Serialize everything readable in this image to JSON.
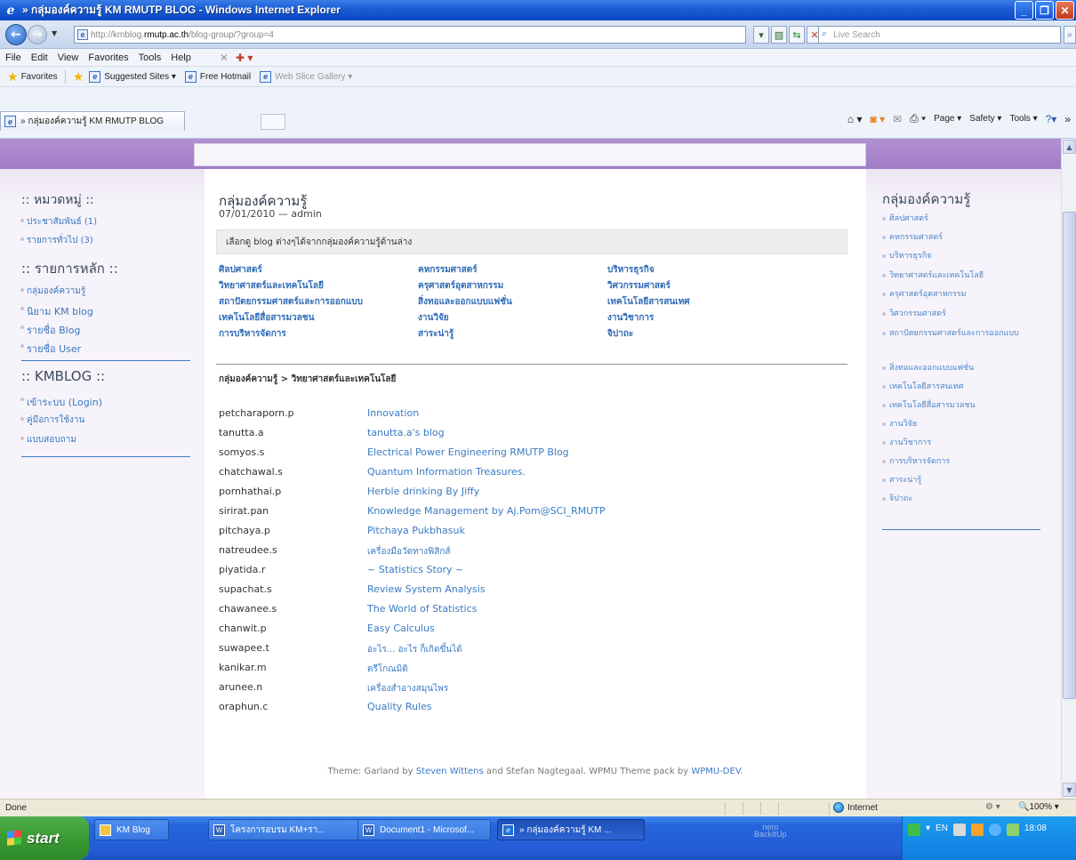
{
  "window": {
    "title": "» กลุ่มองค์ความรู้ KM RMUTP BLOG - Windows Internet Explorer"
  },
  "address": {
    "url_prefix": "http://kmblog.",
    "url_host": "rmutp.ac.th",
    "url_suffix": "/blog-group/?group=4",
    "search_placeholder": "Live Search"
  },
  "menu": [
    "File",
    "Edit",
    "View",
    "Favorites",
    "Tools",
    "Help"
  ],
  "favorites": {
    "label": "Favorites",
    "items": [
      {
        "label": "Suggested Sites ▾",
        "grey": false
      },
      {
        "label": "Free Hotmail",
        "grey": false
      },
      {
        "label": "Web Slice Gallery ▾",
        "grey": true
      }
    ]
  },
  "tab": {
    "label": "» กลุ่มองค์ความรู้ KM RMUTP BLOG"
  },
  "commandbar": [
    "Page ▾",
    "Safety ▾",
    "Tools ▾"
  ],
  "left_sidebar": {
    "h1": ":: หมวดหมู่ ::",
    "cats": [
      "ประชาสัมพันธ์ (1)",
      "รายการทั่วไป (3)"
    ],
    "h2": ":: รายการหลัก ::",
    "main": [
      "กลุ่มองค์ความรู้",
      "นิยาม KM blog",
      "รายชื่อ Blog",
      "รายชื่อ User"
    ],
    "h3": ":: KMBLOG ::",
    "km": [
      "เข้าระบบ (Login)",
      "คู่มือการใช้งาน",
      "แบบสอบถาม"
    ]
  },
  "main": {
    "title": "กลุ่มองค์ความรู้",
    "date": "07/01/2010 — admin",
    "info": "เลือกดู blog ต่างๆได้จากกลุ่มองค์ความรู้ด้านล่าง",
    "categories": [
      [
        "ศิลปศาสตร์",
        "คหกรรมศาสตร์",
        "บริหารธุรกิจ"
      ],
      [
        "วิทยาศาสตร์และเทคโนโลยี",
        "ครุศาสตร์อุตสาหกรรม",
        "วิศวกรรมศาสตร์"
      ],
      [
        "สถาปัตยกรรมศาสตร์และการออกแบบ",
        "สิ่งทอและออกแบบแฟชั่น",
        "เทคโนโลยีสารสนเทศ"
      ],
      [
        "เทคโนโลยีสื่อสารมวลชน",
        "งานวิจัย",
        "งานวิชาการ"
      ],
      [
        "การบริหารจัดการ",
        "สาระน่ารู้",
        "จิปาถะ"
      ]
    ],
    "breadcrumb": "กลุ่มองค์ความรู้ > วิทยาศาสตร์และเทคโนโลยี",
    "blogs": [
      {
        "user": "petcharaporn.p",
        "blog": "Innovation"
      },
      {
        "user": "tanutta.a",
        "blog": "tanutta.a's blog"
      },
      {
        "user": "somyos.s",
        "blog": "Electrical Power Engineering RMUTP Blog"
      },
      {
        "user": "chatchawal.s",
        "blog": "Quantum Information Treasures."
      },
      {
        "user": "pornhathai.p",
        "blog": "Herble drinking By Jiffy"
      },
      {
        "user": "sirirat.pan",
        "blog": "Knowledge Management by Aj.Pom@SCI_RMUTP"
      },
      {
        "user": "pitchaya.p",
        "blog": "Pitchaya Pukbhasuk"
      },
      {
        "user": "natreudee.s",
        "blog": "เครื่องมือวัดทางฟิสิกส์"
      },
      {
        "user": "piyatida.r",
        "blog": "~ Statistics Story ~"
      },
      {
        "user": "supachat.s",
        "blog": "Review System Analysis"
      },
      {
        "user": "chawanee.s",
        "blog": "The World of Statistics"
      },
      {
        "user": "chanwit.p",
        "blog": "Easy Calculus"
      },
      {
        "user": "suwapee.t",
        "blog": "อะไร... อะไร ก็เกิดขึ้นได้"
      },
      {
        "user": "kanikar.m",
        "blog": "ตรีโกณมิติ"
      },
      {
        "user": "arunee.n",
        "blog": "เครื่องสำอางสมุนไพร"
      },
      {
        "user": "oraphun.c",
        "blog": "Quality Rules"
      }
    ],
    "footer": {
      "t1": "Theme: Garland by ",
      "a1": "Steven Wittens",
      "t2": " and Stefan Nagtegaal. WPMU Theme pack by ",
      "a2": "WPMU-DEV",
      "t3": "."
    }
  },
  "right_sidebar": {
    "title": "กลุ่มองค์ความรู้",
    "items": [
      "ศิลปศาสตร์",
      "คหกรรมศาสตร์",
      "บริหารธุรกิจ",
      "วิทยาศาสตร์และเทคโนโลยี",
      "ครุศาสตร์อุตสาหกรรม",
      "วิศวกรรมศาสตร์",
      "สถาปัตยกรรมศาสตร์และการออกแบบ",
      "สิ่งทอและออกแบบแฟชั่น",
      "เทคโนโลยีสารสนเทศ",
      "เทคโนโลยีสื่อสารมวลชน",
      "งานวิจัย",
      "งานวิชาการ",
      "การบริหารจัดการ",
      "สาระน่ารู้",
      "จิปาถะ"
    ]
  },
  "statusbar": {
    "status": "Done",
    "zone": "Internet",
    "zoom": "100%"
  },
  "taskbar": {
    "start": "start",
    "items": [
      "KM Blog",
      "โครงการอบรม KM+รา...",
      "Document1 - Microsof...",
      "» กลุ่มองค์ความรู้ KM ..."
    ],
    "lang": "EN",
    "clock": "18:08"
  }
}
